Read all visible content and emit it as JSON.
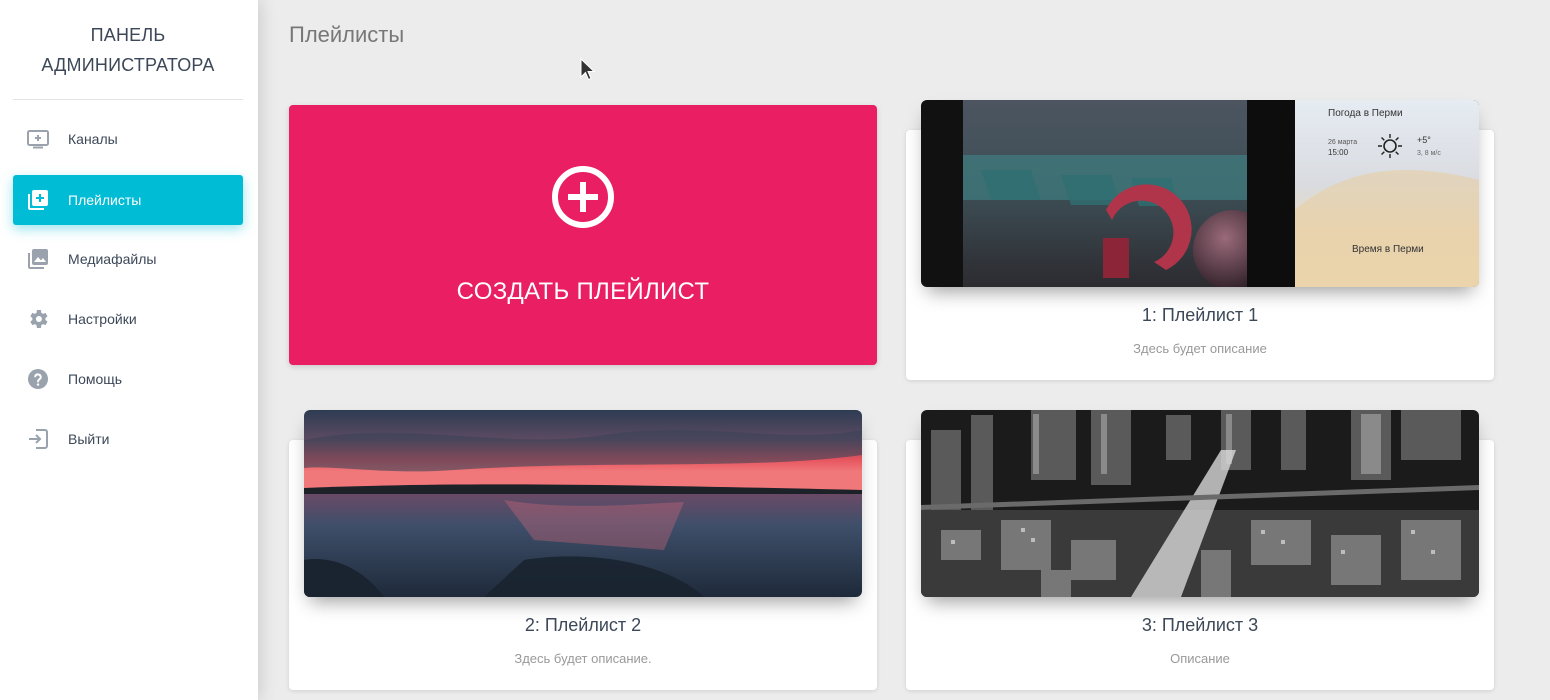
{
  "sidebar": {
    "brand_line1": "ПАНЕЛЬ",
    "brand_line2": "АДМИНИСТРАТОРА",
    "items": [
      {
        "label": "Каналы",
        "icon": "tv-plus-icon",
        "active": false
      },
      {
        "label": "Плейлисты",
        "icon": "library-add-icon",
        "active": true
      },
      {
        "label": "Медиафайлы",
        "icon": "photo-library-icon",
        "active": false
      },
      {
        "label": "Настройки",
        "icon": "gear-icon",
        "active": false
      },
      {
        "label": "Помощь",
        "icon": "help-circle-icon",
        "active": false
      },
      {
        "label": "Выйти",
        "icon": "exit-icon",
        "active": false
      }
    ]
  },
  "page": {
    "title": "Плейлисты"
  },
  "create_card": {
    "label": "СОЗДАТЬ ПЛЕЙЛИСТ",
    "icon": "plus-circle-icon",
    "color": "#e91e63"
  },
  "playlists": [
    {
      "title": "1: Плейлист 1",
      "description": "Здесь будет описание",
      "thumbnail": {
        "weather_header": "Погода в Перми",
        "date": "26 марта",
        "time": "15:00",
        "temperature": "+5°",
        "wind": "3, 8 м/с",
        "clock_caption": "Время в Перми"
      }
    },
    {
      "title": "2: Плейлист 2",
      "description": "Здесь будет описание."
    },
    {
      "title": "3: Плейлист 3",
      "description": "Описание"
    }
  ],
  "colors": {
    "accent": "#00bcd4",
    "create": "#e91e63"
  }
}
